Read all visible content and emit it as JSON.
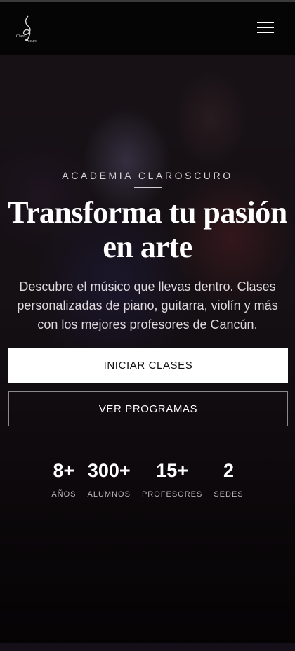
{
  "header": {
    "logo_text": "Claro Oscuro",
    "menu_icon": "hamburger-menu-icon"
  },
  "hero": {
    "eyebrow": "ACADEMIA CLAROSCURO",
    "headline": "Transforma tu pasión en arte",
    "description": "Descubre el músico que llevas dentro. Clases personalizadas de piano, guitarra, violín y más con los mejores profesores de Cancún.",
    "primary_cta": "INICIAR CLASES",
    "secondary_cta": "VER PROGRAMAS"
  },
  "stats": [
    {
      "value": "8+",
      "label": "AÑOS"
    },
    {
      "value": "300+",
      "label": "ALUMNOS"
    },
    {
      "value": "15+",
      "label": "PROFESORES"
    },
    {
      "value": "2",
      "label": "SEDES"
    }
  ],
  "colors": {
    "background": "#070406",
    "header": "#050505",
    "primary_button": "#ffffff",
    "text": "#ffffff"
  }
}
